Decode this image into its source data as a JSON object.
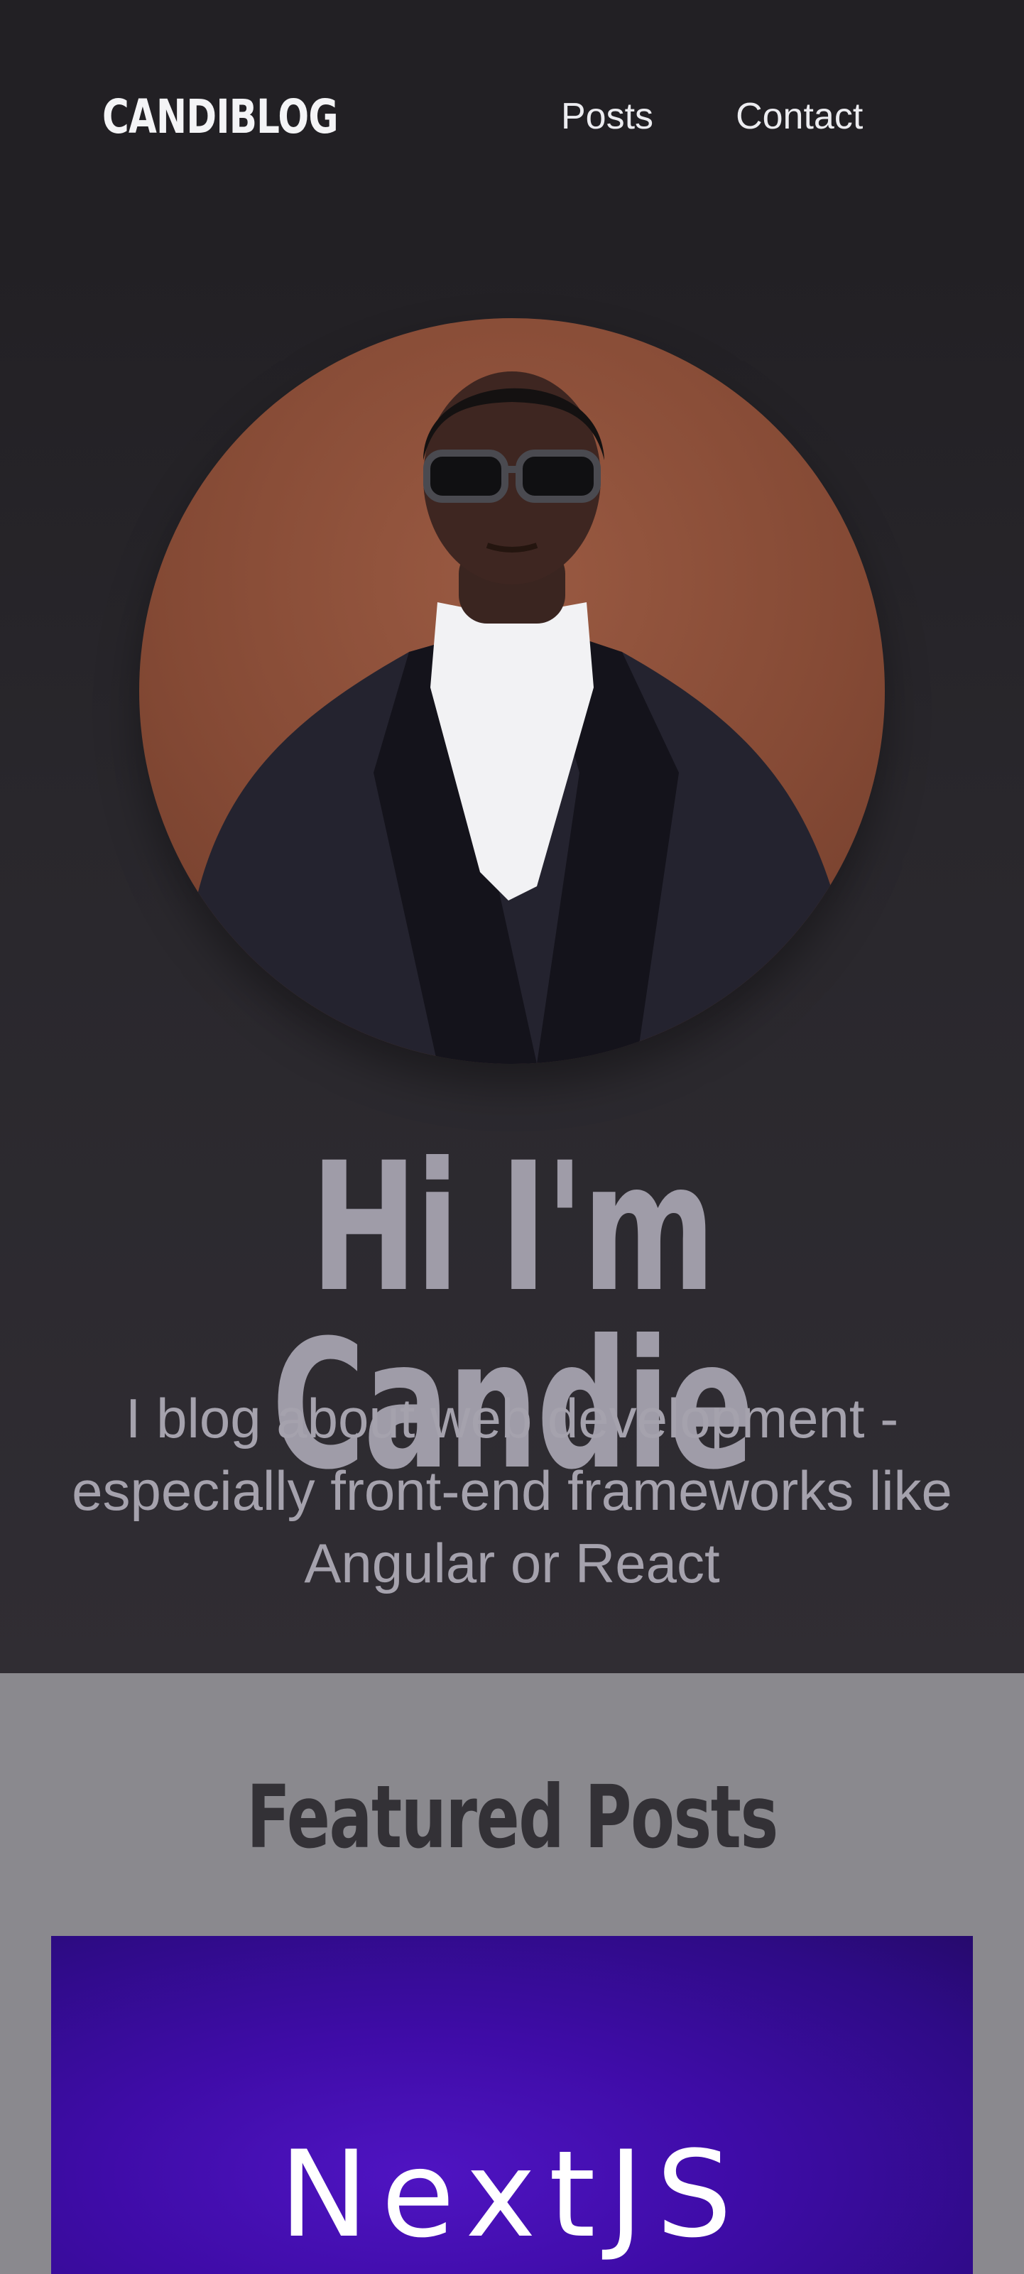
{
  "header": {
    "logo": "CANDIBLOG",
    "nav": [
      {
        "label": "Posts"
      },
      {
        "label": "Contact"
      }
    ]
  },
  "hero": {
    "title": "Hi I'm Candie",
    "subtitle": "I blog about web development - especially front-end frameworks like Angular or React"
  },
  "featured": {
    "heading": "Featured Posts",
    "posts": [
      {
        "title": "NextJS"
      }
    ]
  },
  "colors": {
    "header_bg": "#222024",
    "hero_text": "#9f9ca8",
    "section_bg": "#8a898e",
    "card_accent": "#3f0ca8"
  }
}
